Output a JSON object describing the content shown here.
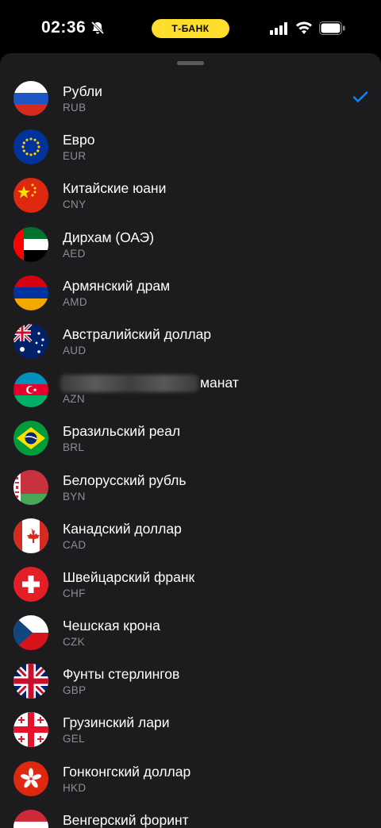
{
  "status_bar": {
    "time": "02:36",
    "bank_label": "Т-БАНК",
    "icons": [
      "bell-slash-icon",
      "signal-icon",
      "wifi-icon",
      "battery-icon"
    ]
  },
  "colors": {
    "accent": "#0a84ff",
    "bank_pill": "#ffdd2d",
    "sheet_bg": "#1c1c1e",
    "secondary_text": "#8e8e93"
  },
  "currencies": [
    {
      "name": "Рубли",
      "code": "RUB",
      "flag": "russia-flag-icon",
      "selected": true
    },
    {
      "name": "Евро",
      "code": "EUR",
      "flag": "eu-flag-icon"
    },
    {
      "name": "Китайские юани",
      "code": "CNY",
      "flag": "china-flag-icon"
    },
    {
      "name": "Дирхам (ОАЭ)",
      "code": "AED",
      "flag": "uae-flag-icon"
    },
    {
      "name": "Армянский драм",
      "code": "AMD",
      "flag": "armenia-flag-icon"
    },
    {
      "name": "Австралийский доллар",
      "code": "AUD",
      "flag": "australia-flag-icon"
    },
    {
      "name": "манат",
      "code": "AZN",
      "flag": "azerbaijan-flag-icon",
      "blurred_prefix": true
    },
    {
      "name": "Бразильский реал",
      "code": "BRL",
      "flag": "brazil-flag-icon"
    },
    {
      "name": "Белорусский рубль",
      "code": "BYN",
      "flag": "belarus-flag-icon"
    },
    {
      "name": "Канадский доллар",
      "code": "CAD",
      "flag": "canada-flag-icon"
    },
    {
      "name": "Швейцарский франк",
      "code": "CHF",
      "flag": "switzerland-flag-icon"
    },
    {
      "name": "Чешская крона",
      "code": "CZK",
      "flag": "czech-flag-icon"
    },
    {
      "name": "Фунты стерлингов",
      "code": "GBP",
      "flag": "uk-flag-icon"
    },
    {
      "name": "Грузинский лари",
      "code": "GEL",
      "flag": "georgia-flag-icon"
    },
    {
      "name": "Гонконгский доллар",
      "code": "HKD",
      "flag": "hongkong-flag-icon"
    },
    {
      "name": "Венгерский форинт",
      "code": "",
      "flag": "hungary-flag-icon"
    }
  ]
}
